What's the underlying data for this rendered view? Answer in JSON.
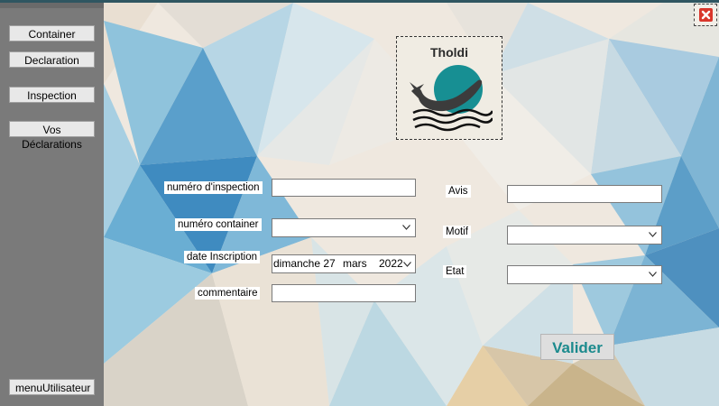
{
  "sidebar": {
    "items": [
      {
        "label": "Container"
      },
      {
        "label": "Declaration"
      },
      {
        "label": "Inspection"
      },
      {
        "label": "Vos Déclarations"
      }
    ],
    "bottom_label": "menuUtilisateur"
  },
  "logo": {
    "text": "Tholdi"
  },
  "form": {
    "numero_inspection": {
      "label": "numéro d'inspection",
      "value": ""
    },
    "numero_container": {
      "label": "numéro container",
      "value": ""
    },
    "date_inscription": {
      "label": "date Inscription",
      "day": "dimanche 27",
      "month": "mars",
      "year": "2022"
    },
    "commentaire": {
      "label": "commentaire",
      "value": ""
    },
    "avis": {
      "label": "Avis",
      "value": ""
    },
    "motif": {
      "label": "Motif",
      "value": ""
    },
    "etat": {
      "label": "Etat",
      "value": ""
    }
  },
  "submit_label": "Valider",
  "colors": {
    "accent": "#1b8a8d",
    "close": "#d9362b",
    "sidebar": "#7a7a7a"
  },
  "icons": {
    "close": "close-icon",
    "combo": "chevron-down-icon"
  }
}
